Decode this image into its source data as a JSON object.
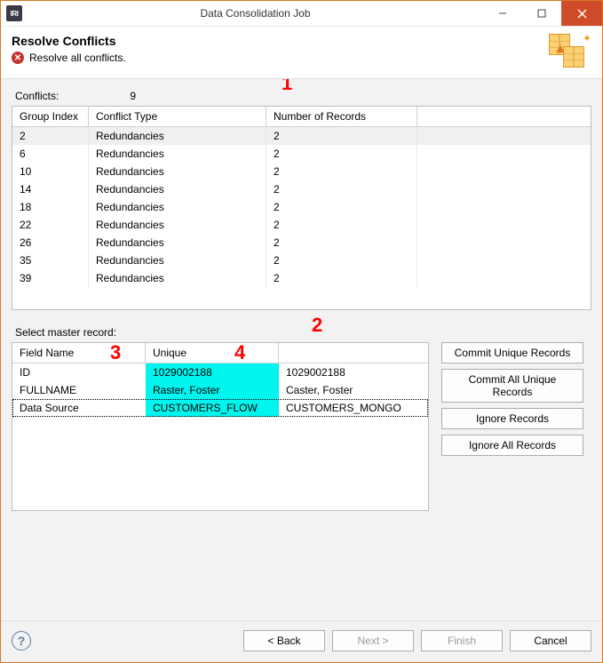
{
  "window": {
    "app_badge": "IRI",
    "title": "Data Consolidation Job"
  },
  "header": {
    "title": "Resolve Conflicts",
    "subtitle": "Resolve all conflicts."
  },
  "conflicts_panel": {
    "label": "Conflicts:",
    "count": "9",
    "columns": {
      "c1": "Group Index",
      "c2": "Conflict Type",
      "c3": "Number of Records"
    },
    "rows": [
      {
        "group": "2",
        "type": "Redundancies",
        "num": "2"
      },
      {
        "group": "6",
        "type": "Redundancies",
        "num": "2"
      },
      {
        "group": "10",
        "type": "Redundancies",
        "num": "2"
      },
      {
        "group": "14",
        "type": "Redundancies",
        "num": "2"
      },
      {
        "group": "18",
        "type": "Redundancies",
        "num": "2"
      },
      {
        "group": "22",
        "type": "Redundancies",
        "num": "2"
      },
      {
        "group": "26",
        "type": "Redundancies",
        "num": "2"
      },
      {
        "group": "35",
        "type": "Redundancies",
        "num": "2"
      },
      {
        "group": "39",
        "type": "Redundancies",
        "num": "2"
      }
    ]
  },
  "master": {
    "label": "Select master record:",
    "columns": {
      "c1": "Field Name",
      "c2": "Unique",
      "c3": ""
    },
    "rows": [
      {
        "field": "ID",
        "unique": "1029002188",
        "other": "1029002188"
      },
      {
        "field": "FULLNAME",
        "unique": "Raster, Foster",
        "other": "Caster, Foster"
      },
      {
        "field": "Data Source",
        "unique": "CUSTOMERS_FLOW",
        "other": "CUSTOMERS_MONGO"
      }
    ]
  },
  "side_buttons": {
    "commit_unique": "Commit Unique Records",
    "commit_all_unique": "Commit All Unique Records",
    "ignore": "Ignore Records",
    "ignore_all": "Ignore All Records"
  },
  "nav": {
    "back": "< Back",
    "next": "Next >",
    "finish": "Finish",
    "cancel": "Cancel"
  },
  "annotations": {
    "a1": "1",
    "a2": "2",
    "a3": "3",
    "a4": "4"
  }
}
